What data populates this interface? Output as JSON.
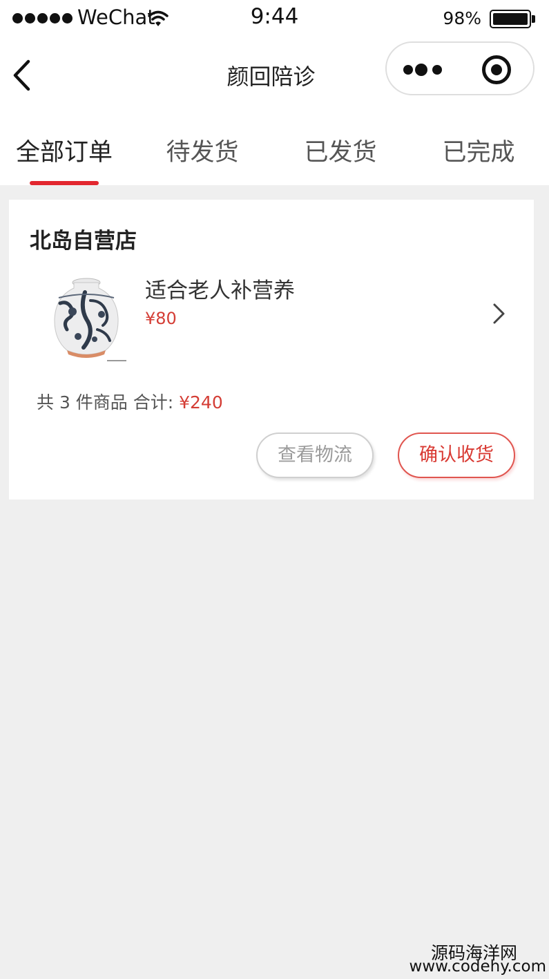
{
  "status_bar": {
    "carrier": "WeChat",
    "time": "9:44",
    "battery": "98%"
  },
  "nav": {
    "title": "颜回陪诊"
  },
  "tabs": [
    {
      "label": "全部订单",
      "active": true
    },
    {
      "label": "待发货",
      "active": false
    },
    {
      "label": "已发货",
      "active": false
    },
    {
      "label": "已完成",
      "active": false
    }
  ],
  "order": {
    "shop_name": "北岛自营店",
    "product": {
      "name": "适合老人补营养",
      "price": "¥80",
      "image_icon": "porcelain-vase-image"
    },
    "summary": {
      "count_text": "共 3 件商品 合计:",
      "total": "¥240"
    },
    "buttons": {
      "logistics": "查看物流",
      "confirm": "确认收货"
    }
  },
  "watermark": {
    "line1": "源码海洋网",
    "line2": "www.codehy.com"
  },
  "colors": {
    "accent": "#e2272f",
    "price": "#d43d35",
    "background": "#efefef"
  }
}
